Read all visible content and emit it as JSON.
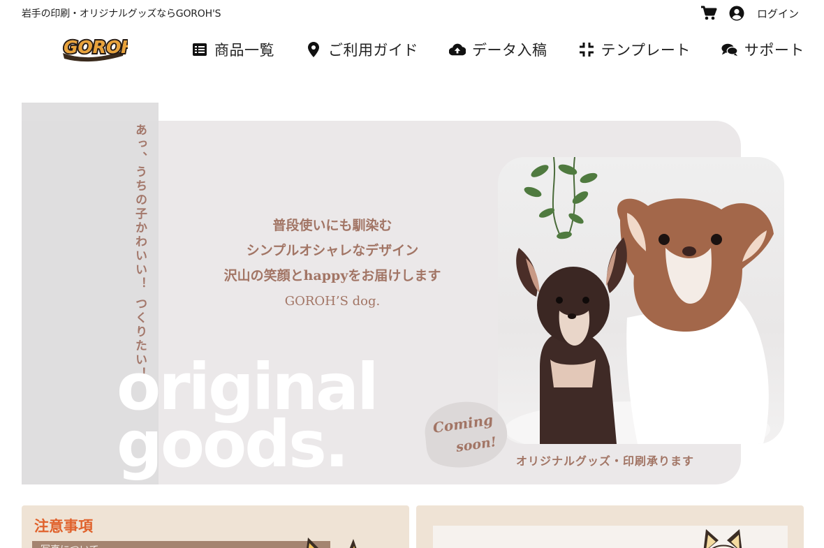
{
  "header": {
    "tagline": "岩手の印刷・オリジナルグッズならGOROH'S",
    "login_label": "ログイン",
    "icons": [
      "cart-icon",
      "user-icon"
    ],
    "logo_text": "GOROH'S"
  },
  "nav": {
    "items": [
      {
        "label": "商品一覧",
        "icon": "list-icon"
      },
      {
        "label": "ご利用ガイド",
        "icon": "map-pin-icon"
      },
      {
        "label": "データ入稿",
        "icon": "cloud-upload-icon"
      },
      {
        "label": "テンプレート",
        "icon": "compress-icon"
      },
      {
        "label": "サポート",
        "icon": "chat-icon"
      }
    ]
  },
  "hero": {
    "vertical_text": "あっ、うちの子かわいい！ つくりたい！",
    "lines": [
      "普段使いにも馴染む",
      "シンプルオシャレなデザイン",
      "沢山の笑顔とhappyをお届けします"
    ],
    "brand": "GOROH’S dog.",
    "big_word_1": "original",
    "big_word_2": "goods.",
    "coming_soon_1": "Coming",
    "coming_soon_2": "soon!",
    "caption": "オリジナルグッズ・印刷承ります"
  },
  "notice_card": {
    "title": "注意事項",
    "subtitle": "写真について"
  },
  "colors": {
    "accent_text": "#a27565",
    "notice_title": "#e0622c",
    "card_bg": "#efe3d5",
    "hero_bg": "#ebe8e9"
  }
}
